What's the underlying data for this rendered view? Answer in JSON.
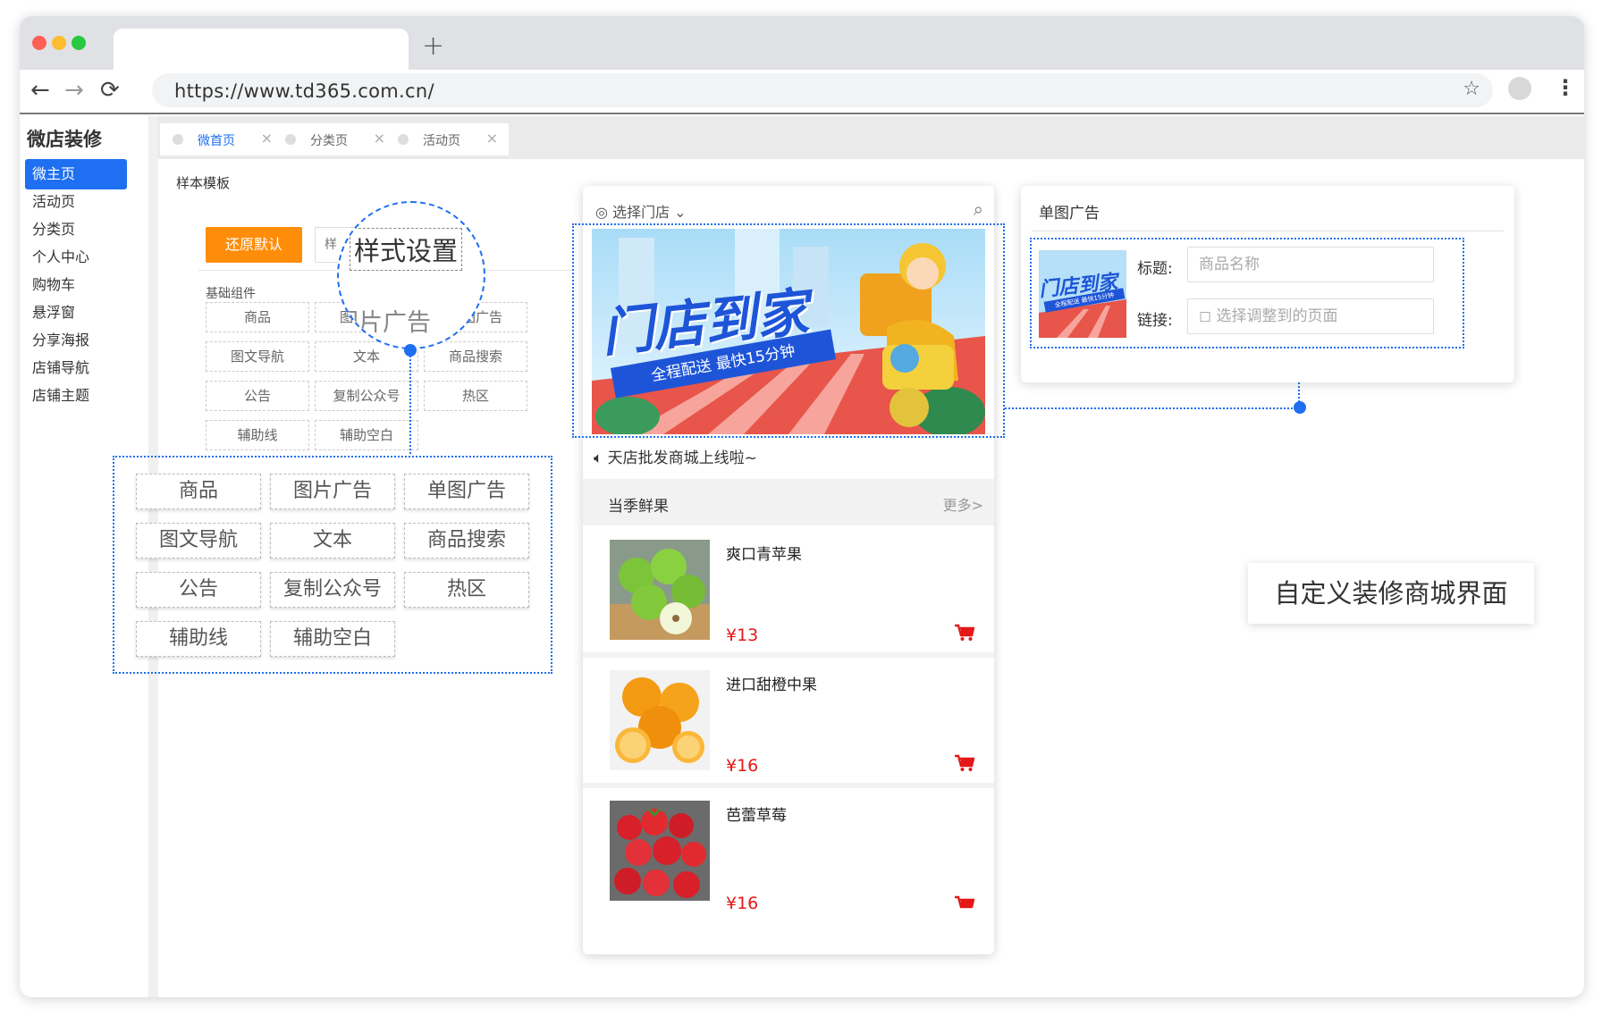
{
  "browser": {
    "url": "https://www.td365.com.cn/",
    "new_tab_symbol": "+",
    "back_icon": "←",
    "forward_icon": "→",
    "reload_icon": "⟳",
    "star_icon": "☆",
    "menu_icon": "⋮"
  },
  "sidebar": {
    "title": "微店装修",
    "items": [
      {
        "label": "微主页",
        "active": true
      },
      {
        "label": "活动页"
      },
      {
        "label": "分类页"
      },
      {
        "label": "个人中心"
      },
      {
        "label": "购物车"
      },
      {
        "label": "悬浮窗"
      },
      {
        "label": "分享海报"
      },
      {
        "label": "店铺导航"
      },
      {
        "label": "店铺主题"
      }
    ]
  },
  "page_tabs": [
    {
      "label": "微首页",
      "active": true
    },
    {
      "label": "分类页"
    },
    {
      "label": "活动页"
    }
  ],
  "tab_close": "×",
  "left_panel": {
    "sample_title": "样本模板",
    "restore_button": "还原默认",
    "style_button_partial": "样",
    "zoom_label": "样式设置",
    "zoom_under": "图片广告",
    "basic_label": "基础组件",
    "components": [
      "商品",
      "图片广告",
      "单图广告",
      "图文导航",
      "文本",
      "商品搜索",
      "公告",
      "复制公众号",
      "热区",
      "辅助线",
      "辅助空白"
    ]
  },
  "phone": {
    "store_select": "选择门店",
    "search_icon": "⌕",
    "banner_title": "门店到家",
    "banner_subtitle": "全程配送 最快15分钟",
    "notice": "天店批发商城上线啦~",
    "section_title": "当季鲜果",
    "section_more": "更多>",
    "products": [
      {
        "name": "爽口青苹果",
        "price": "¥13"
      },
      {
        "name": "进口甜橙中果",
        "price": "¥16"
      },
      {
        "name": "芭蕾草莓",
        "price": "¥16"
      }
    ]
  },
  "config": {
    "title": "单图广告",
    "title_label": "标题:",
    "title_placeholder": "商品名称",
    "link_label": "链接:",
    "link_placeholder": "选择调整到的页面",
    "thumb_title": "门店到家",
    "thumb_sub": "全程配送 最快15分钟"
  },
  "callout": "自定义装修商城界面",
  "colors": {
    "accent": "#1e6ff1",
    "restore": "#ff8d0a",
    "price": "#e61717"
  }
}
